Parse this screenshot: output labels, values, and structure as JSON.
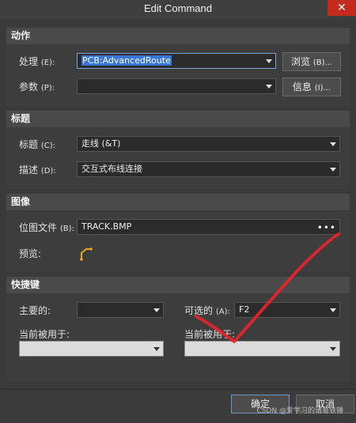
{
  "window": {
    "title": "Edit Command",
    "close_glyph": "✕"
  },
  "action": {
    "header": "动作",
    "process_label": "处理",
    "process_key": "(E):",
    "process_value": "PCB:AdvancedRoute",
    "browse_button": "浏览",
    "browse_key": "(B)...",
    "params_label": "参数",
    "params_key": "(P):",
    "params_value": "",
    "info_button": "信息",
    "info_key": "(I)..."
  },
  "title_section": {
    "header": "标题",
    "caption_label": "标题",
    "caption_key": "(C):",
    "caption_value": "走线 (&T)",
    "desc_label": "描述",
    "desc_key": "(D):",
    "desc_value": "交互式布线连接"
  },
  "image_section": {
    "header": "图像",
    "bitmap_label": "位图文件",
    "bitmap_key": "(B):",
    "bitmap_value": "TRACK.BMP",
    "bitmap_dots": "•••",
    "preview_label": "预览:",
    "preview_icon": "track-route-icon"
  },
  "shortcut_section": {
    "header": "快捷键",
    "primary_label": "主要的:",
    "primary_value": "",
    "alt_label": "可选的",
    "alt_key": "(A):",
    "alt_value": "F2",
    "primary_used_label": "当前被用于:",
    "primary_used_value": "",
    "alt_used_label": "当前被用于:",
    "alt_used_value": ""
  },
  "footer": {
    "ok_button": "确定",
    "cancel_button": "取消",
    "watermark": "CSDN @爱学习的诸葛铁锤"
  },
  "colors": {
    "annotation": "#e8232a",
    "selection": "#3875d7"
  }
}
